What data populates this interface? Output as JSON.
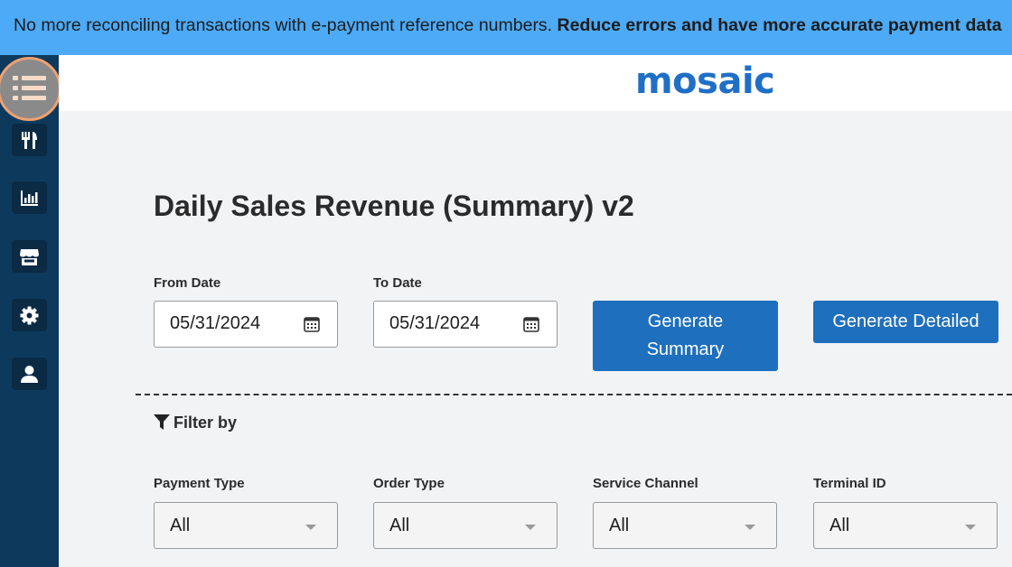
{
  "banner": {
    "text": "No more reconciling transactions with e-payment reference numbers. ",
    "bold_text": "Reduce errors and have more accurate payment data"
  },
  "sidebar": {
    "items": [
      {
        "icon": "list-icon"
      },
      {
        "icon": "utensils-icon"
      },
      {
        "icon": "bar-chart-icon"
      },
      {
        "icon": "store-icon"
      },
      {
        "icon": "gear-icon"
      },
      {
        "icon": "user-icon"
      }
    ]
  },
  "header": {
    "logo": "mosaic"
  },
  "page": {
    "title": "Daily Sales Revenue (Summary) v2"
  },
  "dates": {
    "from_label": "From Date",
    "from_value": "05/31/2024",
    "to_label": "To Date",
    "to_value": "05/31/2024"
  },
  "buttons": {
    "generate_summary": "Generate Summary",
    "generate_detailed": "Generate Detailed"
  },
  "filter": {
    "title": "Filter by",
    "payment_type": {
      "label": "Payment Type",
      "value": "All"
    },
    "order_type": {
      "label": "Order Type",
      "value": "All"
    },
    "service_channel": {
      "label": "Service Channel",
      "value": "All"
    },
    "terminal_id": {
      "label": "Terminal ID",
      "value": "All"
    }
  },
  "colors": {
    "banner": "#4daaf6",
    "sidebar": "#0d3a5c",
    "primary_button": "#1e6fbd",
    "logo": "#1f6fc6"
  }
}
